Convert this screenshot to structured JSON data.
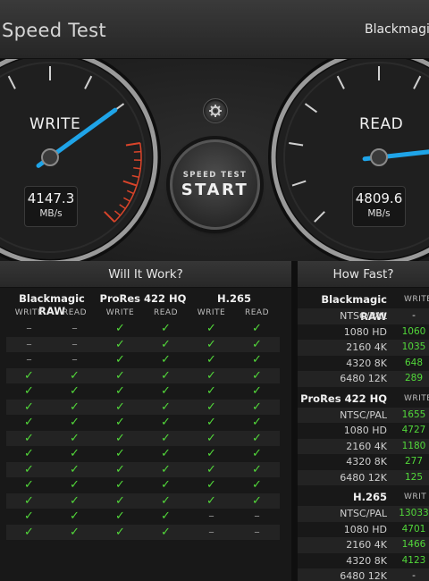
{
  "app": {
    "title": "Speed Test",
    "brand": "Blackmagicdesign"
  },
  "gauges": {
    "write": {
      "label": "WRITE",
      "value": "4147.3",
      "unit": "MB/s",
      "level": 0.7
    },
    "read": {
      "label": "READ",
      "value": "4809.6",
      "unit": "MB/s",
      "level": 0.81
    }
  },
  "start_button": {
    "small": "SPEED TEST",
    "big": "START"
  },
  "will_it_work": {
    "title": "Will It Work?",
    "groups": [
      "Blackmagic RAW",
      "ProRes 422 HQ",
      "H.265"
    ],
    "sub_headers": [
      "WRITE",
      "READ",
      "WRITE",
      "READ",
      "WRITE",
      "READ"
    ],
    "rows": [
      [
        "–",
        "–",
        "✓",
        "✓",
        "✓",
        "✓"
      ],
      [
        "–",
        "–",
        "✓",
        "✓",
        "✓",
        "✓"
      ],
      [
        "–",
        "–",
        "✓",
        "✓",
        "✓",
        "✓"
      ],
      [
        "✓",
        "✓",
        "✓",
        "✓",
        "✓",
        "✓"
      ],
      [
        "✓",
        "✓",
        "✓",
        "✓",
        "✓",
        "✓"
      ],
      [
        "✓",
        "✓",
        "✓",
        "✓",
        "✓",
        "✓"
      ],
      [
        "✓",
        "✓",
        "✓",
        "✓",
        "✓",
        "✓"
      ],
      [
        "✓",
        "✓",
        "✓",
        "✓",
        "✓",
        "✓"
      ],
      [
        "✓",
        "✓",
        "✓",
        "✓",
        "✓",
        "✓"
      ],
      [
        "✓",
        "✓",
        "✓",
        "✓",
        "✓",
        "✓"
      ],
      [
        "✓",
        "✓",
        "✓",
        "✓",
        "✓",
        "✓"
      ],
      [
        "✓",
        "✓",
        "✓",
        "✓",
        "✓",
        "✓"
      ],
      [
        "✓",
        "✓",
        "✓",
        "✓",
        "–",
        "–"
      ],
      [
        "✓",
        "✓",
        "✓",
        "✓",
        "–",
        "–"
      ]
    ]
  },
  "how_fast": {
    "title": "How Fast?",
    "groups": [
      {
        "name": "Blackmagic RAW",
        "header": "WRITE",
        "rows": [
          {
            "label": "NTSC/PAL",
            "value": "-"
          },
          {
            "label": "1080 HD",
            "value": "1060"
          },
          {
            "label": "2160 4K",
            "value": "1035"
          },
          {
            "label": "4320 8K",
            "value": "648"
          },
          {
            "label": "6480 12K",
            "value": "289"
          }
        ]
      },
      {
        "name": "ProRes 422 HQ",
        "header": "WRITE",
        "rows": [
          {
            "label": "NTSC/PAL",
            "value": "1655"
          },
          {
            "label": "1080 HD",
            "value": "4727"
          },
          {
            "label": "2160 4K",
            "value": "1180"
          },
          {
            "label": "4320 8K",
            "value": "277"
          },
          {
            "label": "6480 12K",
            "value": "125"
          }
        ]
      },
      {
        "name": "H.265",
        "header": "WRIT",
        "rows": [
          {
            "label": "NTSC/PAL",
            "value": "13033"
          },
          {
            "label": "1080 HD",
            "value": "4701"
          },
          {
            "label": "2160 4K",
            "value": "1466"
          },
          {
            "label": "4320 8K",
            "value": "4123"
          },
          {
            "label": "6480 12K",
            "value": "-"
          }
        ]
      }
    ]
  },
  "colors": {
    "accent_needle": "#1fa4e8",
    "ok": "#52d83a",
    "redline": "#d9442a"
  }
}
